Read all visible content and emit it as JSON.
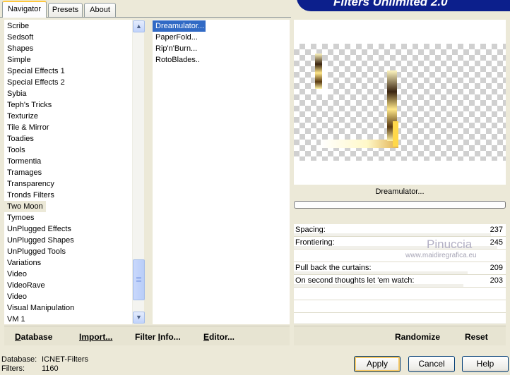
{
  "tabs": [
    {
      "label": "Navigator",
      "active": true
    },
    {
      "label": "Presets",
      "active": false
    },
    {
      "label": "About",
      "active": false
    }
  ],
  "banner": {
    "title": "Filters Unlimited 2.0"
  },
  "categories": [
    {
      "label": "Scribe"
    },
    {
      "label": "Sedsoft"
    },
    {
      "label": "Shapes"
    },
    {
      "label": "Simple"
    },
    {
      "label": "Special Effects 1"
    },
    {
      "label": "Special Effects 2"
    },
    {
      "label": "Sybia"
    },
    {
      "label": "Teph's Tricks"
    },
    {
      "label": "Texturize"
    },
    {
      "label": "Tile & Mirror"
    },
    {
      "label": "Toadies"
    },
    {
      "label": "Tools"
    },
    {
      "label": "Tormentia"
    },
    {
      "label": "Tramages"
    },
    {
      "label": "Transparency"
    },
    {
      "label": "Tronds Filters"
    },
    {
      "label": "Two Moon",
      "state": "current"
    },
    {
      "label": "Tymoes"
    },
    {
      "label": "UnPlugged Effects"
    },
    {
      "label": "UnPlugged Shapes"
    },
    {
      "label": "UnPlugged Tools"
    },
    {
      "label": "Variations"
    },
    {
      "label": "Video"
    },
    {
      "label": "VideoRave"
    },
    {
      "label": "Video"
    },
    {
      "label": "Visual Manipulation"
    },
    {
      "label": "VM 1"
    }
  ],
  "filters": [
    {
      "label": "Dreamulator...",
      "selected": true
    },
    {
      "label": "PaperFold..."
    },
    {
      "label": "Rip'n'Burn..."
    },
    {
      "label": "RotoBlades.."
    }
  ],
  "left_buttons": {
    "database": {
      "first": "D",
      "rest": "atabase"
    },
    "import": {
      "first": "I",
      "rest": "mport..."
    },
    "filter_info": {
      "first": "Filter ",
      "u": "I",
      "rest": "nfo..."
    },
    "editor": {
      "first": "E",
      "rest": "ditor..."
    }
  },
  "right_buttons": {
    "randomize": "Randomize",
    "reset": "Reset"
  },
  "current_filter": "Dreamulator...",
  "params": [
    {
      "label": "Spacing:",
      "value": "237",
      "level": 0.93
    },
    {
      "label": "Frontiering:",
      "value": "245",
      "level": 0.96
    },
    {
      "label": "",
      "value": ""
    },
    {
      "label": "Pull back the curtains:",
      "value": "209",
      "level": 0.82
    },
    {
      "label": "On second thoughts let 'em watch:",
      "value": "203",
      "level": 0.8
    }
  ],
  "watermark": {
    "name": "Pinuccia",
    "url": "www.maidiregrafica.eu"
  },
  "status": {
    "database_label": "Database:",
    "database_value": "ICNET-Filters",
    "filters_label": "Filters:",
    "filters_value": "1160"
  },
  "dialog_buttons": {
    "apply": "Apply",
    "cancel": "Cancel",
    "help": "Help"
  },
  "colors": {
    "selection": "#316ac5",
    "banner": "#0c1f8c",
    "face": "#ece9d8"
  }
}
